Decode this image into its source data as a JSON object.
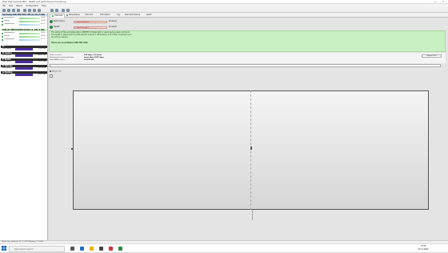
{
  "window": {
    "title": "Hard Disk Sentinel PRO - Health and performance monitoring"
  },
  "menu": [
    "File",
    "Disk",
    "Report",
    "Configuration",
    "Help"
  ],
  "sidebar": {
    "disk_header": "Samsung SSD 860 EVO 1TB (0, 931.5 GB)",
    "perf_rows": [
      {
        "label": "Performance",
        "value": "100%",
        "color": "#2b8a3e"
      },
      {
        "label": "Health",
        "value": "100%",
        "color": "#2b8a3e"
      },
      {
        "label": "Temperature",
        "value": "33 °C",
        "color": "#2b8a3e"
      }
    ],
    "disk_header2": "Hitachi HDS721010CLA332 (1, 931.5 GB)",
    "perf_rows2": [
      {
        "label": "Performance",
        "value": "100%",
        "color": "#2b8a3e"
      },
      {
        "label": "Health",
        "value": "100%",
        "color": "#2b8a3e"
      },
      {
        "label": "Temperature",
        "value": "35 °C",
        "color": "#2b8a3e"
      }
    ],
    "drives": [
      {
        "name": "C: ",
        "total": "465.7 GB",
        "free_label": "Free space",
        "free": "112.4 GB"
      },
      {
        "name": "D: Games",
        "total": "931.4 GB",
        "free_label": "Free space",
        "free": "466.1 GB"
      },
      {
        "name": "E: Media",
        "total": "931.5 GB",
        "free_label": "Free space",
        "free": "250.7 GB"
      },
      {
        "name": "F: Storage",
        "total": "931.5 GB",
        "free_label": "Free space",
        "free": "311.9 GB"
      },
      {
        "name": "G: Backup",
        "total": "465.7 GB",
        "free_label": "Free space",
        "free": "203.4 GB"
      }
    ]
  },
  "tabs": [
    "Overview",
    "Temperature",
    "S.M.A.R.T.",
    "Information",
    "Log",
    "Disk Performance",
    "Alerts"
  ],
  "health": [
    {
      "label": "Performance:",
      "bar_text": "100 % Excellent",
      "state": "Excellent"
    },
    {
      "label": "Health:",
      "bar_text": "100 % Excellent",
      "state": "Excellent"
    }
  ],
  "banner_lines": [
    "The status of the solid state disk is PERFECT. Problematic or weak sectors were not found.",
    "The health is determined by SSD specific S.M.A.R.T. attribute(s): #177 Wear Leveling Count",
    "No actions needed.",
    "",
    "There are no problems with this disk."
  ],
  "info": [
    {
      "key": "Power on time:",
      "value": "185 days, 15 hours"
    },
    {
      "key": "Estimated remaining lifetime:",
      "value": "more than 1000 days"
    },
    {
      "key": "Total NAND writes:",
      "value": "23,532 GB"
    }
  ],
  "detail_button": "Repeat Test",
  "checkbox_label": "Repeat test",
  "chart_axis_label": "Disk Sentinel",
  "status": "Status last updated: 23.11.2020 Monday 17:55:45",
  "taskbar": {
    "search_placeholder": "Type here to search",
    "time": "17:55",
    "date": "23.11.2020"
  }
}
